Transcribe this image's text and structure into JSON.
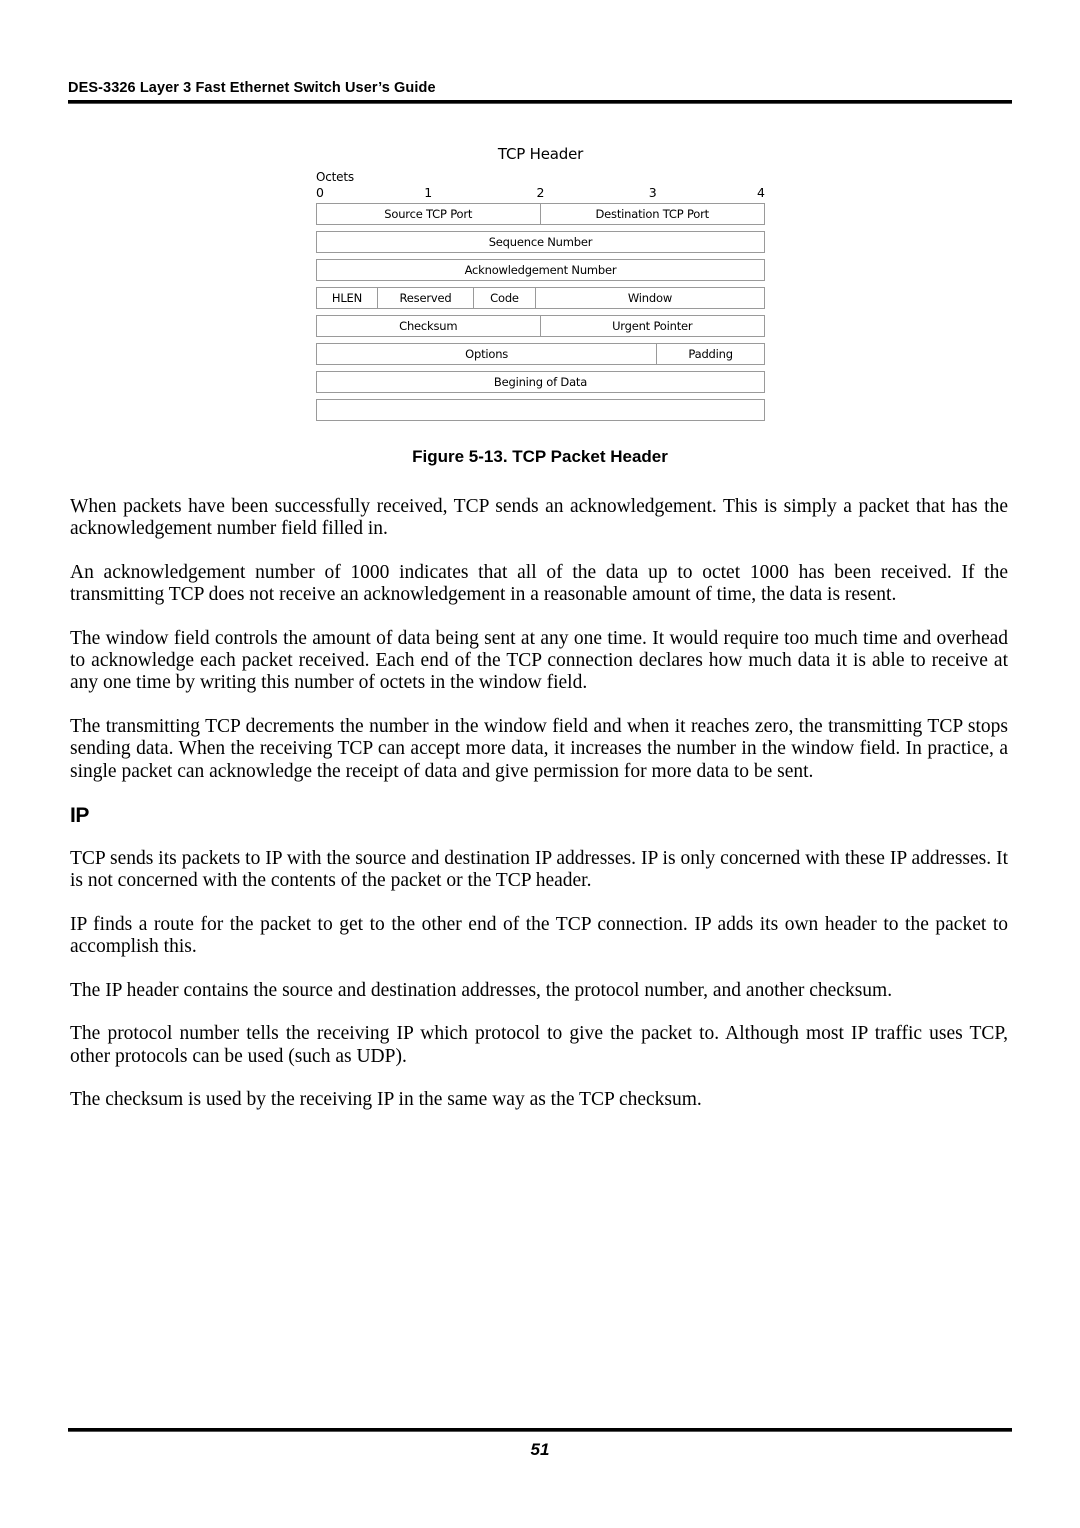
{
  "header": {
    "running_title": "DES-3326 Layer 3 Fast Ethernet Switch User’s Guide"
  },
  "figure": {
    "diagram_title": "TCP Header",
    "octets_label": "Octets",
    "scale_ticks": [
      "0",
      "1",
      "2",
      "3",
      "4"
    ],
    "caption": "Figure 5-13.  TCP Packet Header",
    "rows": [
      {
        "cells": [
          {
            "label": "Source TCP Port",
            "width_pct": 50
          },
          {
            "label": "Destination TCP Port",
            "width_pct": 50
          }
        ]
      },
      {
        "cells": [
          {
            "label": "Sequence Number",
            "width_pct": 100
          }
        ]
      },
      {
        "cells": [
          {
            "label": "Acknowledgement Number",
            "width_pct": 100
          }
        ]
      },
      {
        "cells": [
          {
            "label": "HLEN",
            "width_pct": 13.8
          },
          {
            "label": "Reserved",
            "width_pct": 21.4
          },
          {
            "label": "Code",
            "width_pct": 13.8
          },
          {
            "label": "Window",
            "width_pct": 51.0
          }
        ]
      },
      {
        "cells": [
          {
            "label": "Checksum",
            "width_pct": 50
          },
          {
            "label": "Urgent Pointer",
            "width_pct": 50
          }
        ]
      },
      {
        "cells": [
          {
            "label": "Options",
            "width_pct": 76
          },
          {
            "label": "Padding",
            "width_pct": 24
          }
        ]
      },
      {
        "cells": [
          {
            "label": "Begining of Data",
            "width_pct": 100
          }
        ]
      },
      {
        "cells": [
          {
            "label": "",
            "width_pct": 100
          }
        ]
      }
    ]
  },
  "body": {
    "paragraphs": [
      "When packets have been successfully received, TCP sends an acknowledgement. This is simply a packet that has the acknowledgement number field filled in.",
      "An acknowledgement number of 1000 indicates that all of the data up to octet 1000 has been received. If the transmitting TCP does not receive an acknowledgement in a reasonable amount of time, the data is resent.",
      "The window field controls the amount of data being sent at any one time. It would require too much time and overhead to acknowledge each packet received. Each end of the TCP connection declares how much data it is able to receive at any one time by writing this number of octets in the window field.",
      "The transmitting TCP decrements the number in the window field and when it reaches zero, the transmitting TCP stops sending data. When the receiving TCP can accept more data, it increases the number in the window field. In practice, a single packet can acknowledge the receipt of data and give permission for more data to be sent."
    ],
    "section_heading": "IP",
    "paragraphs_after_heading": [
      "TCP sends its packets to IP with the source and destination IP addresses. IP is only concerned with these IP addresses. It is not concerned with the contents of the packet or the TCP header.",
      "IP finds a route for the packet to get to the other end of the TCP connection. IP adds its own header to the packet to accomplish this.",
      "The IP header contains the source and destination addresses, the protocol number, and another checksum.",
      "The protocol number tells the receiving IP which protocol to give the packet to. Although most IP traffic uses TCP, other protocols can be used (such as UDP).",
      "The checksum is used by the receiving IP in the same way as the TCP checksum."
    ]
  },
  "footer": {
    "page_number": "51"
  }
}
